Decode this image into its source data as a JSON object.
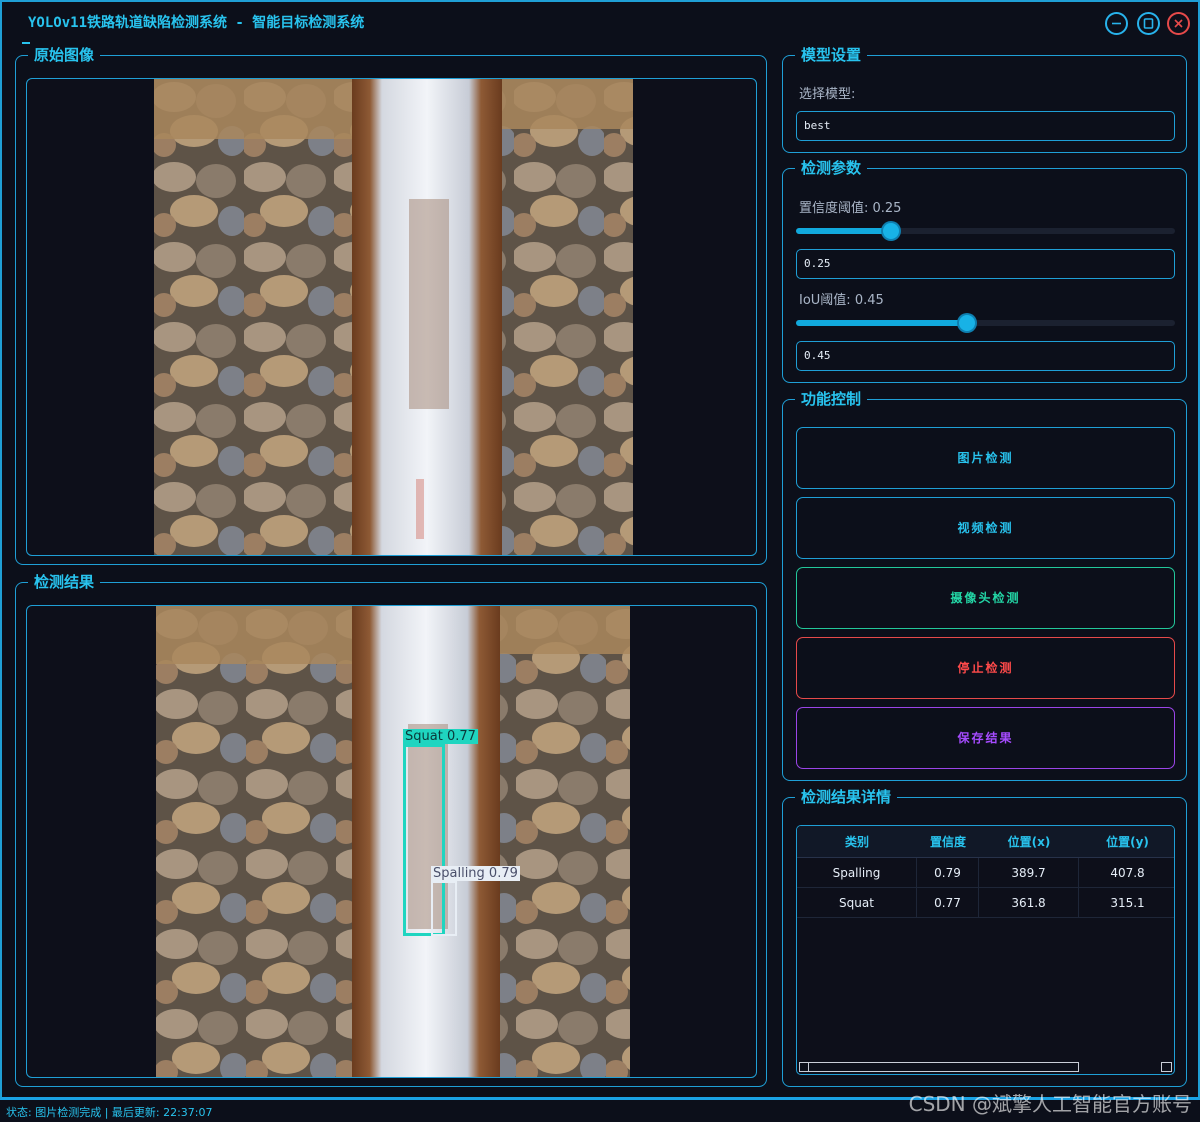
{
  "window": {
    "title": "YOLOv11铁路轨道缺陷检测系统 - 智能目标检测系统",
    "controls": [
      "minimize-icon",
      "maximize-icon",
      "close-icon"
    ]
  },
  "original": {
    "title": "原始图像"
  },
  "result": {
    "title": "检测结果",
    "detections": [
      {
        "label": "Squat 0.77",
        "color": "#1fd5c0"
      },
      {
        "label": "Spalling 0.79",
        "color": "#e8eef5"
      }
    ]
  },
  "model": {
    "title": "模型设置",
    "select_label": "选择模型:",
    "selected": "best"
  },
  "params": {
    "title": "检测参数",
    "conf_label": "置信度阈值: 0.25",
    "conf_value": "0.25",
    "conf_fraction": 0.25,
    "iou_label": "IoU阈值: 0.45",
    "iou_value": "0.45",
    "iou_fraction": 0.45
  },
  "controls": {
    "title": "功能控制",
    "buttons": [
      {
        "label": "图片检测",
        "color": "#28c3ee"
      },
      {
        "label": "视频检测",
        "color": "#28c3ee"
      },
      {
        "label": "摄像头检测",
        "color": "#23d6a6"
      },
      {
        "label": "停止检测",
        "color": "#ff4a4a"
      },
      {
        "label": "保存结果",
        "color": "#a64bff"
      }
    ]
  },
  "details": {
    "title": "检测结果详情",
    "columns": [
      "类别",
      "置信度",
      "位置(x)",
      "位置(y)"
    ],
    "rows": [
      [
        "Spalling",
        "0.79",
        "389.7",
        "407.8"
      ],
      [
        "Squat",
        "0.77",
        "361.8",
        "315.1"
      ]
    ]
  },
  "status": {
    "text": "状态: 图片检测完成 | 最后更新: 22:37:07"
  },
  "watermark": "CSDN @斌擎人工智能官方账号",
  "colors": {
    "accent": "#28c3ee",
    "border": "#1f9fd6",
    "background": "#0c0f1a"
  }
}
